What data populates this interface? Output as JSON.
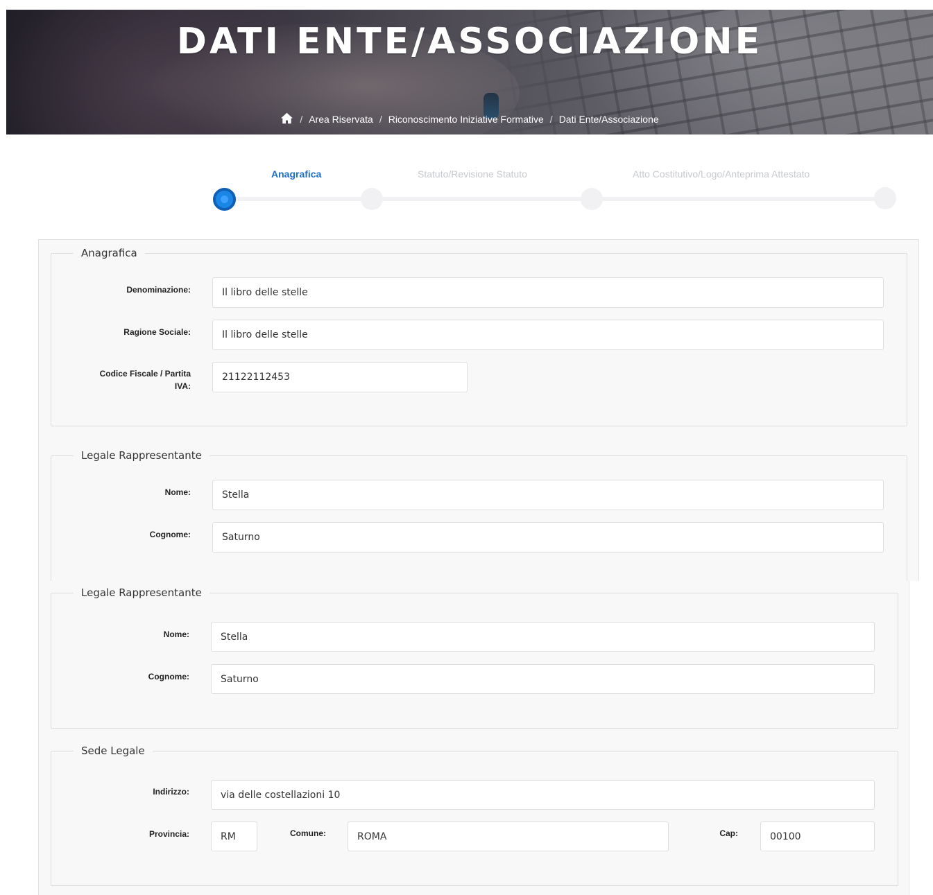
{
  "hero": {
    "title": "DATI ENTE/ASSOCIAZIONE",
    "breadcrumb": [
      "Area Riservata",
      "Riconoscimento Iniziative Formative",
      "Dati Ente/Associazione"
    ],
    "separator": "/"
  },
  "stepper": {
    "steps": [
      {
        "label": "Anagrafica",
        "active": true
      },
      {
        "label": "Statuto/Revisione Statuto",
        "active": false
      },
      {
        "label": "Atto Costitutivo/Logo/Anteprima Attestato",
        "active": false
      }
    ],
    "active_color": "#1a86e6"
  },
  "anagrafica": {
    "legend": "Anagrafica",
    "denominazione_label": "Denominazione:",
    "denominazione_value": "Il libro delle stelle",
    "ragione_label": "Ragione Sociale:",
    "ragione_value": "Il libro delle stelle",
    "cf_label_line1": "Codice Fiscale / Partita",
    "cf_label_line2": "IVA:",
    "cf_value": "21122112453"
  },
  "legale_1": {
    "legend": "Legale Rappresentante",
    "nome_label": "Nome:",
    "nome_value": "Stella",
    "cognome_label": "Cognome:",
    "cognome_value": "Saturno"
  },
  "legale_2": {
    "legend": "Legale Rappresentante",
    "nome_label": "Nome:",
    "nome_value": "Stella",
    "cognome_label": "Cognome:",
    "cognome_value": "Saturno"
  },
  "sede": {
    "legend": "Sede Legale",
    "indirizzo_label": "Indirizzo:",
    "indirizzo_value": "via delle costellazioni 10",
    "provincia_label": "Provincia:",
    "provincia_value": "RM",
    "comune_label": "Comune:",
    "comune_value": "ROMA",
    "cap_label": "Cap:",
    "cap_value": "00100"
  }
}
